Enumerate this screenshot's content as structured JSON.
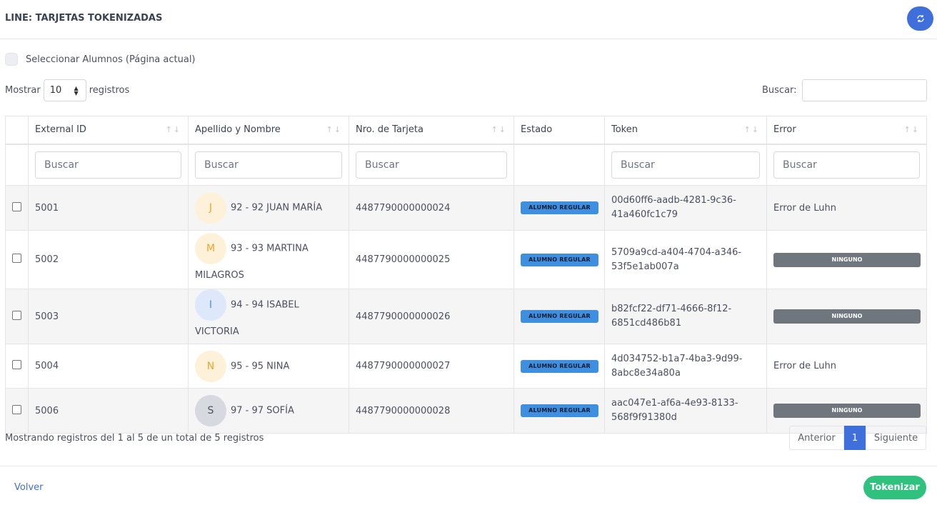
{
  "header": {
    "title": "LINE: TARJETAS TOKENIZADAS",
    "refresh_icon": "refresh-icon"
  },
  "select_all": {
    "label": "Seleccionar Alumnos (Página actual)"
  },
  "length": {
    "prefix": "Mostrar",
    "value": "10",
    "suffix": "registros"
  },
  "search": {
    "label": "Buscar:"
  },
  "table": {
    "columns": [
      "External ID",
      "Apellido y Nombre",
      "Nro. de Tarjeta",
      "Estado",
      "Token",
      "Error"
    ],
    "filter_placeholder": "Buscar",
    "rows": [
      {
        "id": "5001",
        "initial": "J",
        "name": "92 - 92 JUAN MARÍA",
        "card": "4487790000000024",
        "estado": "ALUMNO REGULAR",
        "token1": "00d60ff6-aadb-4281-9c36-",
        "token2": "41a460fc1c79",
        "error": "Error de Luhn",
        "avatar_bg": "#fdf1d9",
        "avatar_fg": "#e8a732"
      },
      {
        "id": "5002",
        "initial": "M",
        "name": "93 - 93 MARTINA",
        "name2": "MILAGROS",
        "card": "4487790000000025",
        "estado": "ALUMNO REGULAR",
        "token1": "5709a9cd-a404-4704-a346-",
        "token2": "53f5e1ab007a",
        "error": "NINGUNO",
        "avatar_bg": "#fdf1d9",
        "avatar_fg": "#e8a732"
      },
      {
        "id": "5003",
        "initial": "I",
        "name": "94 - 94 ISABEL VICTORIA",
        "card": "4487790000000026",
        "estado": "ALUMNO REGULAR",
        "token1": "b82fcf22-df71-4666-8f12-",
        "token2": "6851cd486b81",
        "error": "NINGUNO",
        "avatar_bg": "#dde9fa",
        "avatar_fg": "#5a8de0"
      },
      {
        "id": "5004",
        "initial": "N",
        "name": "95 - 95 NINA",
        "card": "4487790000000027",
        "estado": "ALUMNO REGULAR",
        "token1": "4d034752-b1a7-4ba3-9d99-",
        "token2": "8abc8e34a80a",
        "error": "Error de Luhn",
        "avatar_bg": "#fdf1d9",
        "avatar_fg": "#e8a732"
      },
      {
        "id": "5006",
        "initial": "S",
        "name": "97 - 97 SOFÍA",
        "card": "4487790000000028",
        "estado": "ALUMNO REGULAR",
        "token1": "aac047e1-af6a-4e93-8133-",
        "token2": "568f9f91380d",
        "error": "NINGUNO",
        "avatar_bg": "#d7d9e0",
        "avatar_fg": "#4b5060"
      }
    ]
  },
  "footer": {
    "info": "Mostrando registros del 1 al 5 de un total de 5 registros",
    "prev": "Anterior",
    "current": "1",
    "next": "Siguiente"
  },
  "actions": {
    "back": "Volver",
    "tokenize": "Tokenizar"
  },
  "colors": {
    "primary": "#3f6fdb",
    "success": "#2ec27e",
    "estado_badge": "#3f8fe0",
    "none_badge": "#6f767e"
  }
}
